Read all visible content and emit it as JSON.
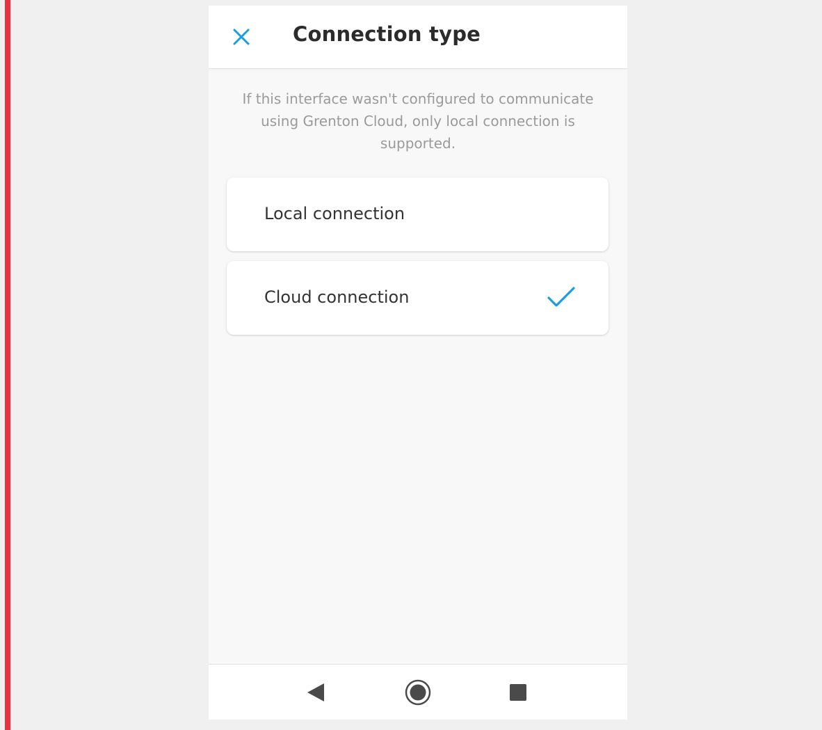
{
  "header": {
    "title": "Connection type",
    "close_icon": "close-icon"
  },
  "info_text": "If this interface wasn't configured to communicate using Grenton Cloud, only local connection is supported.",
  "options": [
    {
      "label": "Local connection",
      "selected": false
    },
    {
      "label": "Cloud connection",
      "selected": true
    }
  ],
  "nav": {
    "back_icon": "back-triangle-icon",
    "home_icon": "home-circle-icon",
    "recent_icon": "recent-square-icon"
  },
  "colors": {
    "accent": "#1a9ee3",
    "title_text": "#2b2b2b",
    "info_text": "#9a9a9a",
    "side_bar": "#e8323f",
    "nav_icon": "#4a4a4a"
  }
}
